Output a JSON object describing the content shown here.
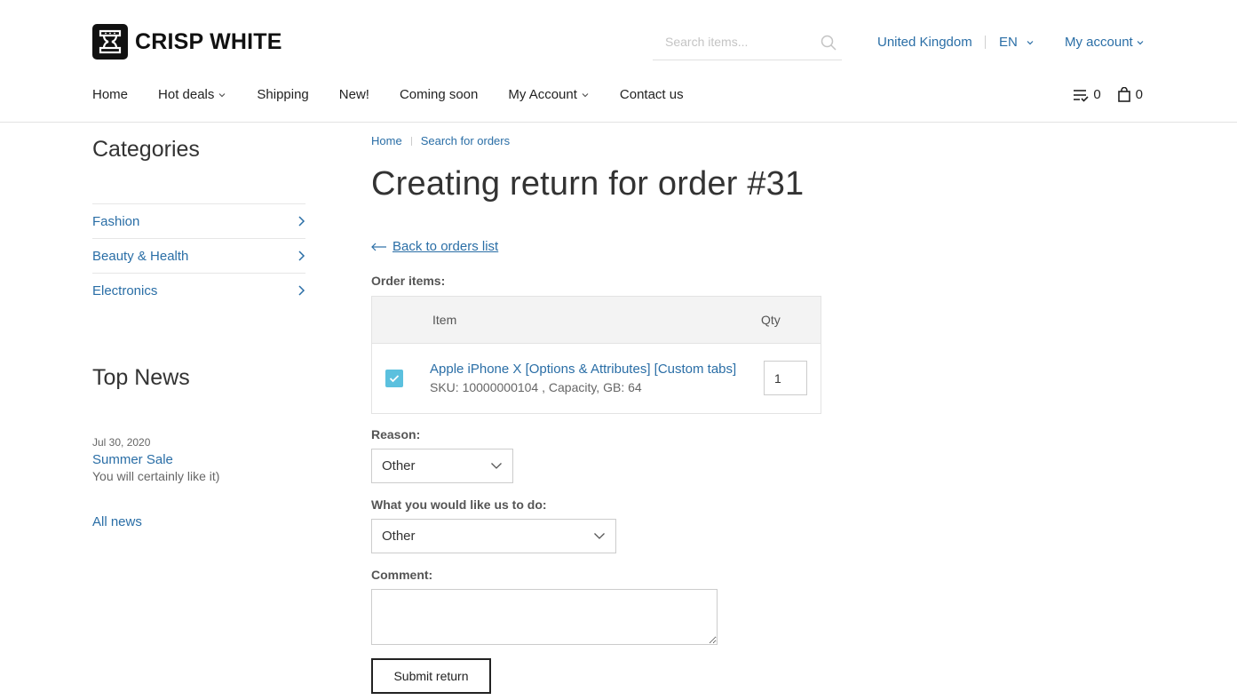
{
  "header": {
    "logo_text": "CRISP WHITE",
    "search_placeholder": "Search items...",
    "country": "United Kingdom",
    "language": "EN",
    "account": "My account"
  },
  "nav": {
    "items": [
      {
        "label": "Home",
        "dropdown": false
      },
      {
        "label": "Hot deals",
        "dropdown": true
      },
      {
        "label": "Shipping",
        "dropdown": false
      },
      {
        "label": "New!",
        "dropdown": false
      },
      {
        "label": "Coming soon",
        "dropdown": false
      },
      {
        "label": "My Account",
        "dropdown": true
      },
      {
        "label": "Contact us",
        "dropdown": false
      }
    ],
    "compare_count": "0",
    "cart_count": "0"
  },
  "sidebar": {
    "categories_title": "Categories",
    "categories": [
      "Fashion",
      "Beauty & Health",
      "Electronics"
    ],
    "news_title": "Top News",
    "news": {
      "date": "Jul 30, 2020",
      "title": "Summer Sale",
      "text": "You will certainly like it)"
    },
    "all_news": "All news"
  },
  "main": {
    "breadcrumb": [
      "Home",
      "Search for orders"
    ],
    "title": "Creating return for order #31",
    "back_link": "Back to orders list",
    "order_items_label": "Order items:",
    "table": {
      "col_item": "Item",
      "col_qty": "Qty",
      "rows": [
        {
          "checked": true,
          "name": "Apple iPhone X [Options & Attributes] [Custom tabs]",
          "details": "SKU: 10000000104 , Capacity, GB: 64",
          "qty": "1"
        }
      ]
    },
    "reason_label": "Reason:",
    "reason_value": "Other",
    "action_label": "What you would like us to do:",
    "action_value": "Other",
    "comment_label": "Comment:",
    "comment_value": "",
    "submit_label": "Submit return"
  },
  "colors": {
    "link": "#2a6ea6",
    "checkbox": "#5bc0de",
    "text": "#333333"
  }
}
